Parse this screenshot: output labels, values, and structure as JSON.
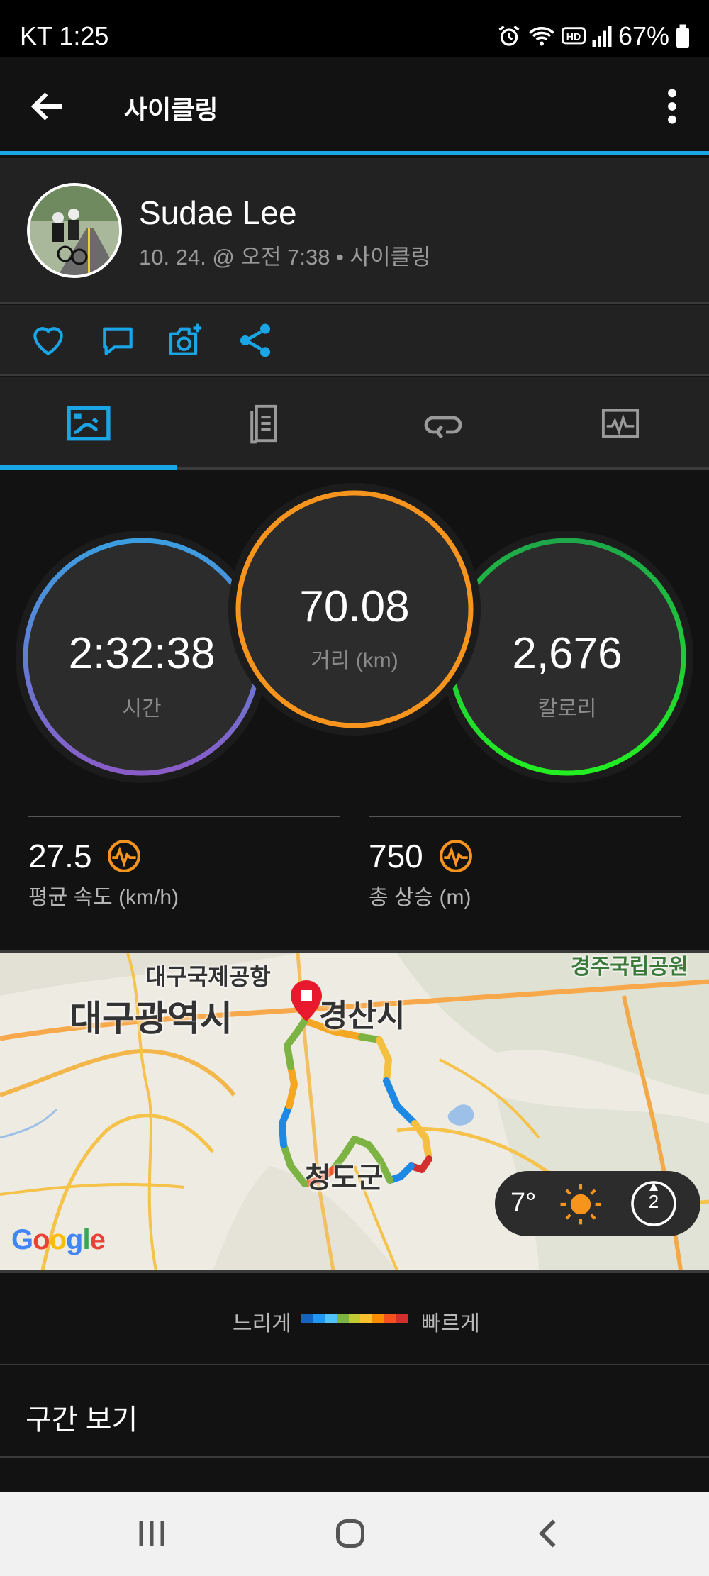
{
  "status_bar": {
    "carrier_time": "KT 1:25",
    "battery": "67%",
    "icons": [
      "alarm-icon",
      "wifi-icon",
      "hd-icon",
      "signal-icon",
      "battery-icon"
    ]
  },
  "app_bar": {
    "title": "사이클링",
    "icons": [
      "back-arrow-icon",
      "more-vert-icon"
    ]
  },
  "profile": {
    "name": "Sudae Lee",
    "meta": "10. 24. @ 오전 7:38 • 사이클링"
  },
  "actions": [
    "heart-icon",
    "comment-icon",
    "add-photo-icon",
    "share-icon"
  ],
  "tabs": [
    {
      "name": "overview",
      "icon": "activity-overview-icon",
      "selected": true
    },
    {
      "name": "details",
      "icon": "document-icon",
      "selected": false
    },
    {
      "name": "laps",
      "icon": "loop-icon",
      "selected": false
    },
    {
      "name": "charts",
      "icon": "chart-icon",
      "selected": false
    }
  ],
  "stats": {
    "time": {
      "value": "2:32:38",
      "label": "시간"
    },
    "distance": {
      "value": "70.08",
      "label": "거리 (km)"
    },
    "calories": {
      "value": "2,676",
      "label": "칼로리"
    },
    "avg_speed": {
      "value": "27.5",
      "label": "평균 속도 (km/h)"
    },
    "total_ascent": {
      "value": "750",
      "label": "총 상승 (m)"
    }
  },
  "map": {
    "labels": {
      "airport": "대구국제공항",
      "city_daegu": "대구광역시",
      "city_gyeongsan": "경산시",
      "county": "청도군",
      "park": "경주국립공원"
    },
    "weather": {
      "temperature": "7°",
      "wind": "2"
    },
    "attribution": "Google"
  },
  "legend": {
    "slow": "느리게",
    "fast": "빠르게",
    "colors": [
      "#1565c0",
      "#2196f3",
      "#4fc3f7",
      "#7cb342",
      "#c0ca33",
      "#fbc02d",
      "#fb8c00",
      "#f4511e",
      "#d32f2f"
    ]
  },
  "segments": {
    "label": "구간 보기"
  },
  "colors": {
    "accent": "#1aa6e6",
    "time_ring": [
      "#3a9ee0",
      "#8a5cc8"
    ],
    "distance_ring": "#f7941d",
    "calories_ring": [
      "#1ec84a",
      "#22dd22"
    ],
    "pulse_icon": "#f7941d"
  }
}
